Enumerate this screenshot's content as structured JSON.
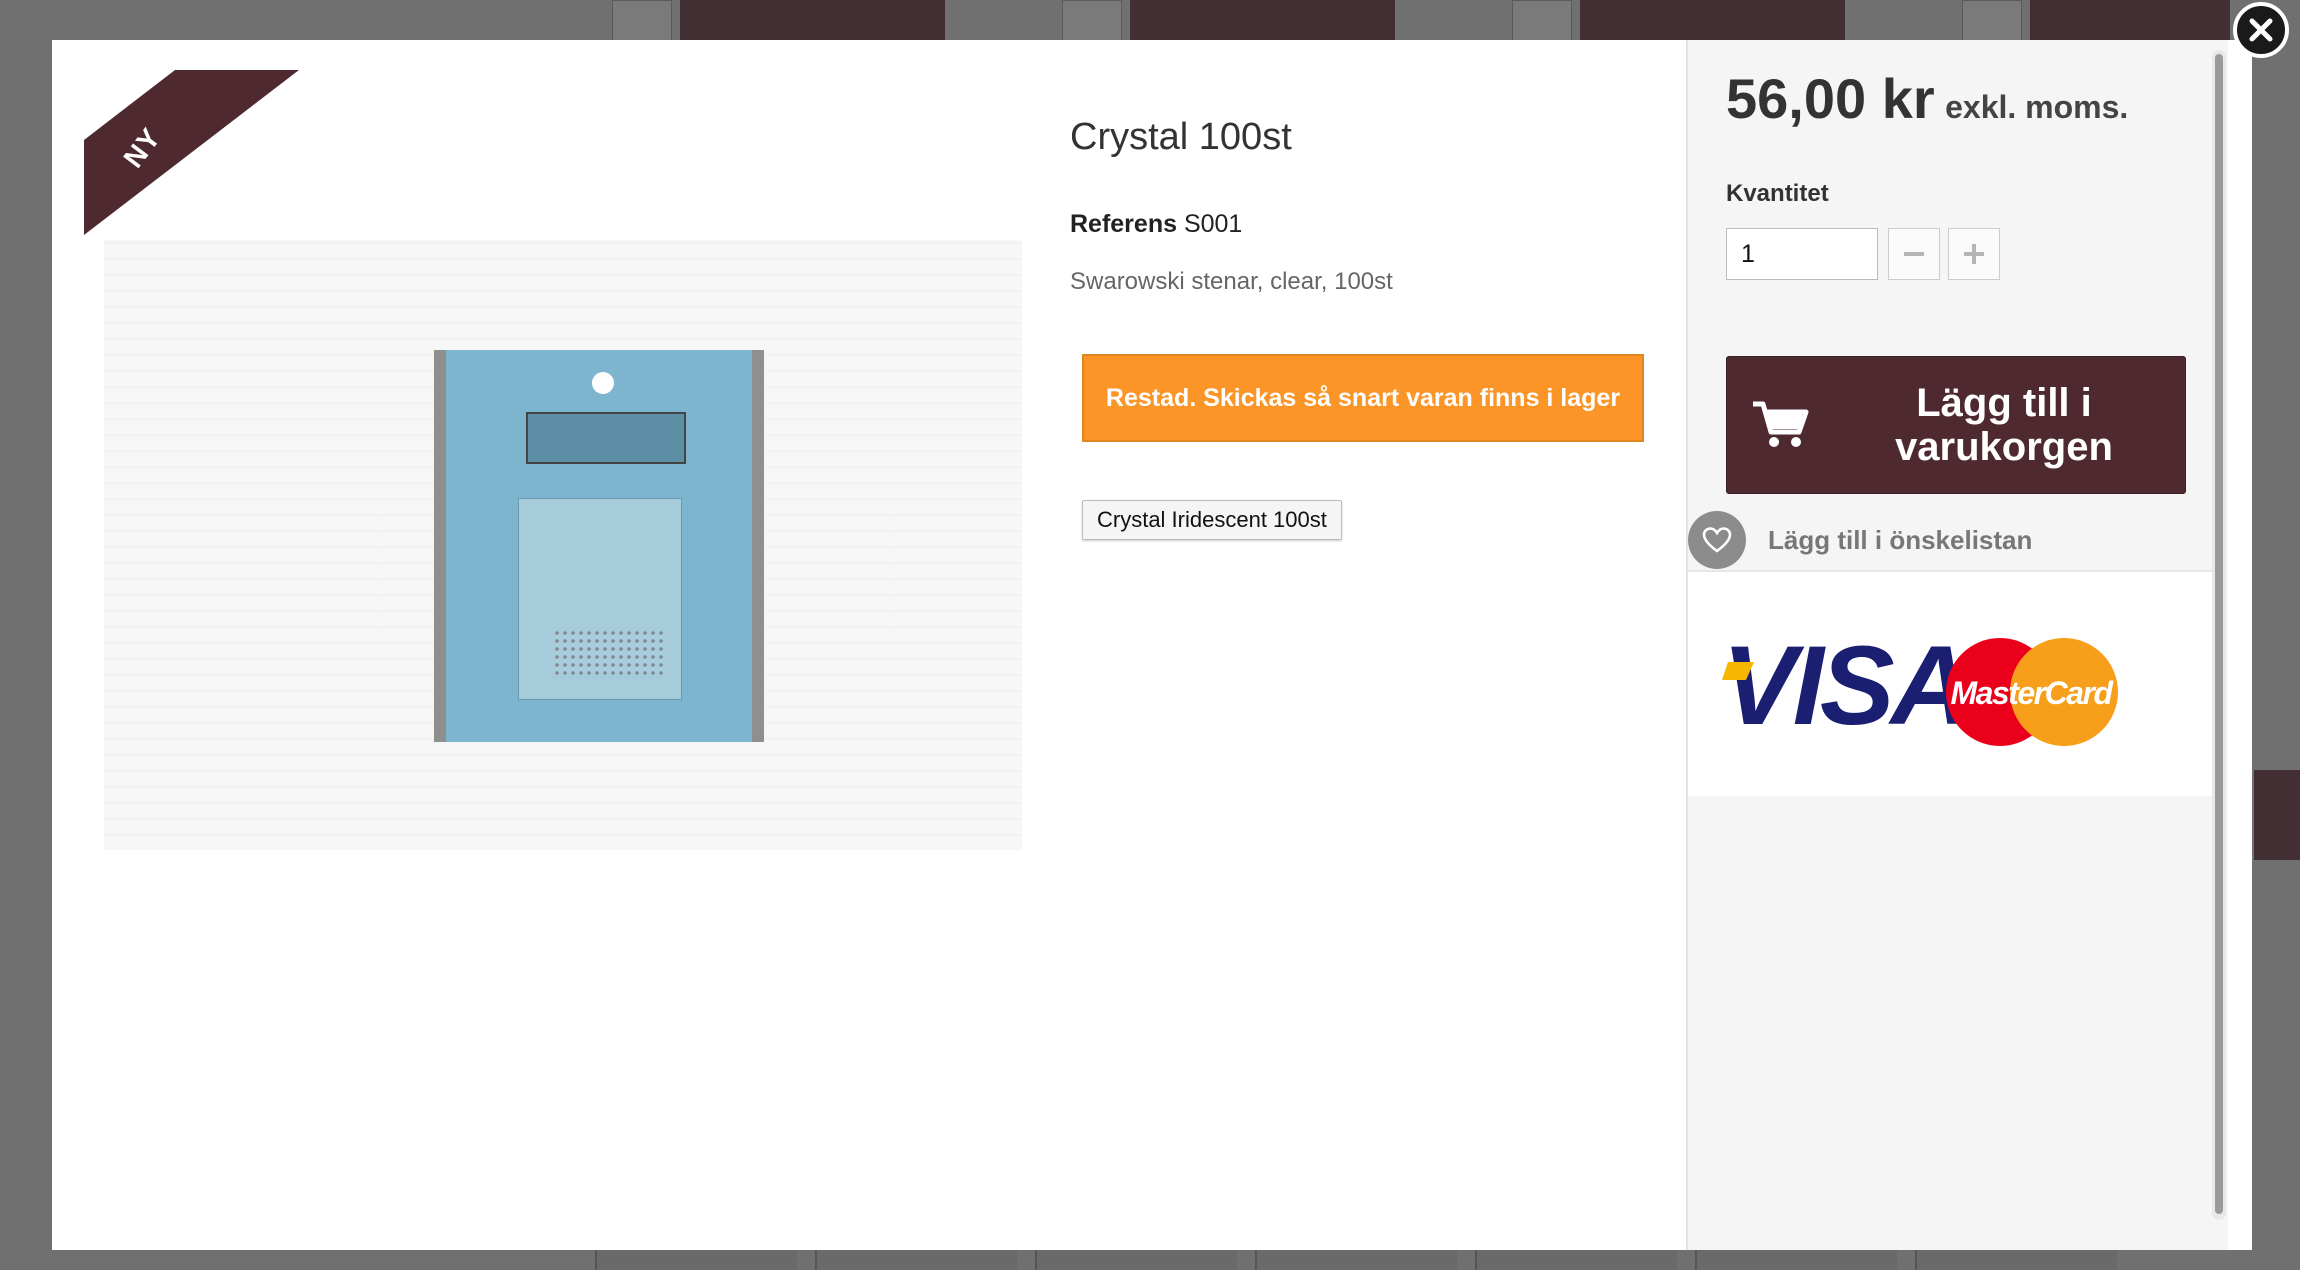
{
  "product": {
    "badge": "NY",
    "title": "Crystal 100st",
    "reference_label": "Referens",
    "reference_value": "S001",
    "description": "Swarowski stenar, clear, 100st",
    "stock_notice": "Restad. Skickas så snart varan finns i lager",
    "variant_button": "Crystal Iridescent 100st",
    "image_alt": "product-package-image"
  },
  "purchase": {
    "price": "56,00 kr",
    "price_suffix": "exkl. moms.",
    "quantity_label": "Kvantitet",
    "quantity_value": "1",
    "add_to_cart": "Lägg till i varukorgen",
    "wishlist": "Lägg till i önskelistan",
    "payment_logos": [
      "VISA",
      "MasterCard"
    ]
  },
  "colors": {
    "brand": "#4e2a30",
    "alert": "#fc9527",
    "visa_blue": "#1a1f71",
    "visa_gold": "#f7b600",
    "mc_red": "#eb001b",
    "mc_orange": "#f79e1b"
  },
  "icons": {
    "close": "close-icon",
    "cart": "cart-icon",
    "heart": "heart-icon",
    "minus": "minus-icon",
    "plus": "plus-icon"
  }
}
